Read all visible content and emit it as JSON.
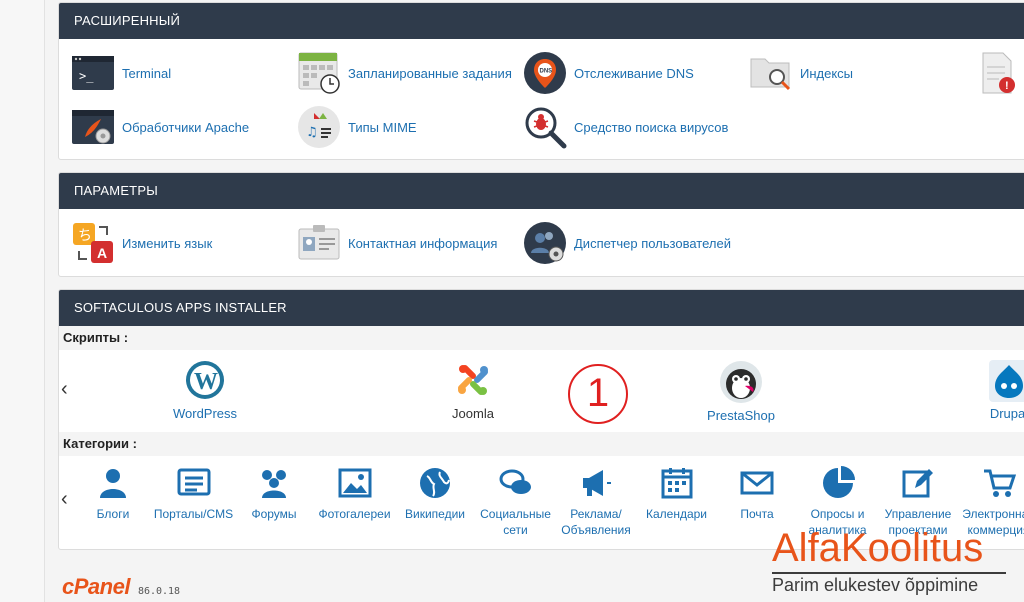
{
  "advanced": {
    "title": "РАСШИРЕННЫЙ",
    "items": [
      {
        "label": "Terminal",
        "icon": "terminal-icon"
      },
      {
        "label": "Запланированные задания",
        "icon": "calendar-clock-icon"
      },
      {
        "label": "Отслеживание DNS",
        "icon": "dns-pin-icon"
      },
      {
        "label": "Индексы",
        "icon": "folder-search-icon"
      },
      {
        "label": "Обработчики Apache",
        "icon": "apache-handler-icon"
      },
      {
        "label": "Типы MIME",
        "icon": "mime-icon"
      },
      {
        "label": "Средство поиска вирусов",
        "icon": "virus-scan-icon"
      }
    ]
  },
  "preferences": {
    "title": "ПАРАМЕТРЫ",
    "items": [
      {
        "label": "Изменить язык",
        "icon": "language-icon"
      },
      {
        "label": "Контактная информация",
        "icon": "contact-card-icon"
      },
      {
        "label": "Диспетчер пользователей",
        "icon": "user-manager-icon"
      }
    ]
  },
  "softaculous": {
    "title": "SOFTACULOUS APPS INSTALLER",
    "scripts_label": "Скрипты :",
    "scripts": [
      "WordPress",
      "Joomla",
      "PrestaShop",
      "Drupal"
    ],
    "categories_label": "Категории :",
    "categories": [
      [
        "Блоги"
      ],
      [
        "Порталы/CMS"
      ],
      [
        "Форумы"
      ],
      [
        "Фотогалереи"
      ],
      [
        "Википедии"
      ],
      [
        "Социальные",
        "сети"
      ],
      [
        "Реклама/",
        "Объявления"
      ],
      [
        "Календари"
      ],
      [
        "Почта"
      ],
      [
        "Опросы и",
        "аналитика"
      ],
      [
        "Управление",
        "проектами"
      ],
      [
        "Электронная",
        "коммерция"
      ]
    ],
    "prev_arrow": "‹"
  },
  "annotation": "1",
  "footer": {
    "brand": "cPanel",
    "version": "86.0.18"
  },
  "watermark": {
    "title": "AlfaKoolitus",
    "subtitle": "Parim elukestev õppimine"
  },
  "colors": {
    "header_bg": "#2f3b4b",
    "link": "#1d6fb0",
    "accent": "#e8541a",
    "annotation": "#e02020"
  }
}
